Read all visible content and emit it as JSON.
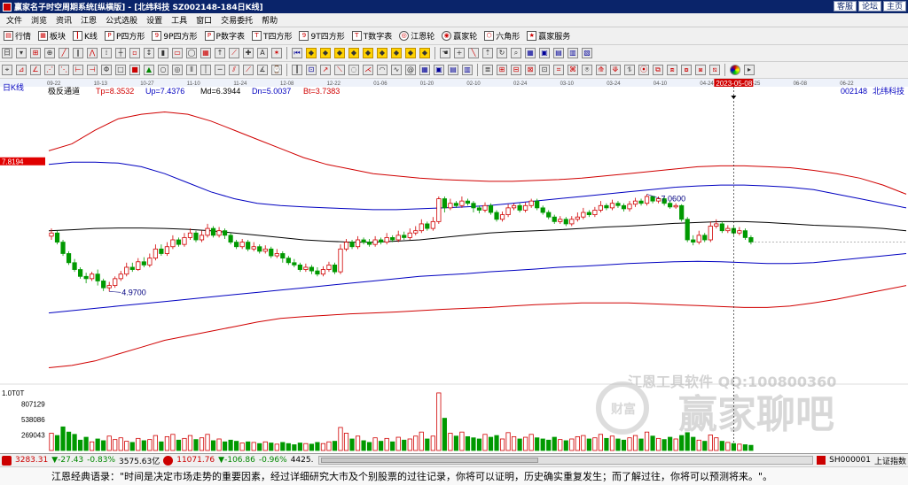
{
  "window": {
    "title": "赢家名子时空周期系统[纵横版] - [北纬科技  SZ002148-184日K线]",
    "links": [
      "客服",
      "论坛",
      "主页"
    ]
  },
  "menu": [
    "文件",
    "浏览",
    "资讯",
    "江恩",
    "公式选股",
    "设置",
    "工具",
    "窗口",
    "交易委托",
    "帮助"
  ],
  "toolbar1": [
    {
      "label": "行情",
      "icon": "quote-icon"
    },
    {
      "label": "板块",
      "icon": "sector-icon"
    },
    {
      "label": "K线",
      "icon": "kline-icon"
    },
    {
      "label": "P四方形",
      "icon": "p-square-icon"
    },
    {
      "label": "9P四方形",
      "icon": "9p-square-icon"
    },
    {
      "label": "P数字表",
      "icon": "p-table-icon"
    },
    {
      "label": "T四方形",
      "icon": "t-square-icon"
    },
    {
      "label": "9T四方形",
      "icon": "9t-square-icon"
    },
    {
      "label": "T数字表",
      "icon": "t-table-icon"
    },
    {
      "label": "江恩轮",
      "icon": "gann-wheel-icon"
    },
    {
      "label": "赢家轮",
      "icon": "winner-wheel-icon"
    },
    {
      "label": "六角形",
      "icon": "hexagon-icon"
    },
    {
      "label": "赢家服务",
      "icon": "service-icon"
    }
  ],
  "chart": {
    "panel_label": "日K线",
    "indicator_name": "极反通道",
    "params": [
      {
        "label": "Tp=8.3532",
        "color": "#d00000"
      },
      {
        "label": "Up=7.4376",
        "color": "#0000c0"
      },
      {
        "label": "Md=6.3944",
        "color": "#000000"
      },
      {
        "label": "Dn=5.0037",
        "color": "#0000c0"
      },
      {
        "label": "Bt=3.7383",
        "color": "#d00000"
      }
    ],
    "stock_code": "002148",
    "stock_name": "北纬科技",
    "price_tag": "7.8194",
    "volume_top_label": "1.0T0T",
    "volume_ticks": [
      "807129",
      "538086",
      "269043"
    ],
    "cursor_date": "2023-05-08",
    "low_label": "4.9700",
    "high_label": "7.0600",
    "date_ticks": [
      "09-22",
      "10-13",
      "10-27",
      "11-10",
      "11-24",
      "12-08",
      "12-22",
      "01-06",
      "01-20",
      "02-10",
      "02-24",
      "03-10",
      "03-24",
      "04-10",
      "04-24",
      "05-25",
      "06-08",
      "06-22"
    ],
    "watermark_line1": "江恩工具软件   QQ:100800360",
    "watermark_line2": "赢家聊吧",
    "watermark_logo": "财富"
  },
  "status": {
    "sh_index": "3283.31",
    "sh_change": "▼-27.43",
    "sh_pct": "-0.83%",
    "sh_amount": "3575.63亿",
    "sz_index": "11071.76",
    "sz_change": "▼-106.86",
    "sz_pct": "-0.96%",
    "sz_amount": "4425.",
    "right_code": "SH000001",
    "right_name": "上证指数"
  },
  "quote": "江恩经典语录：\"时间是决定市场走势的重要因素，经过详细研究大市及个别股票的过往记录，你将可以证明，历史确实重复发生；而了解过往，你将可以预测将来。\"。",
  "colors": {
    "up": "#d00000",
    "down": "#009900",
    "upper_band": "#d00000",
    "mid_band": "#0000c0",
    "middle": "#000000"
  },
  "chart_data": {
    "type": "candlestick",
    "title": "",
    "xlabel": "",
    "ylabel": "",
    "ylim": [
      3.0,
      9.2
    ],
    "vol_ylim": [
      0,
      1076172
    ],
    "bands": {
      "Tp": [
        8.05,
        8.2,
        8.5,
        8.75,
        8.85,
        8.9,
        8.85,
        8.7,
        8.5,
        8.3,
        8.1,
        7.9,
        7.75,
        7.65,
        7.55,
        7.5,
        7.45,
        7.42,
        7.4,
        7.38,
        7.38,
        7.4,
        7.42,
        7.45,
        7.5,
        7.55,
        7.6,
        7.65,
        7.7,
        7.72,
        7.72,
        7.7,
        7.68,
        7.62,
        7.55,
        7.45,
        7.3,
        7.1
      ],
      "Up": [
        7.75,
        7.8,
        7.8,
        7.78,
        7.7,
        7.55,
        7.35,
        7.15,
        7.0,
        6.9,
        6.85,
        6.82,
        6.8,
        6.78,
        6.76,
        6.76,
        6.78,
        6.8,
        6.82,
        6.85,
        6.9,
        6.95,
        7.0,
        7.05,
        7.1,
        7.15,
        7.2,
        7.25,
        7.28,
        7.3,
        7.3,
        7.28,
        7.25,
        7.2,
        7.1,
        7.0,
        6.9,
        6.8
      ],
      "Md": [
        6.3,
        6.32,
        6.35,
        6.36,
        6.36,
        6.35,
        6.33,
        6.3,
        6.25,
        6.2,
        6.15,
        6.1,
        6.07,
        6.05,
        6.05,
        6.07,
        6.1,
        6.15,
        6.2,
        6.25,
        6.28,
        6.3,
        6.32,
        6.35,
        6.38,
        6.4,
        6.43,
        6.46,
        6.48,
        6.5,
        6.5,
        6.48,
        6.45,
        6.42,
        6.4,
        6.38,
        6.35,
        6.3
      ],
      "Dn": [
        4.5,
        4.55,
        4.6,
        4.65,
        4.7,
        4.75,
        4.8,
        4.85,
        4.9,
        4.95,
        5.0,
        5.05,
        5.1,
        5.15,
        5.2,
        5.25,
        5.3,
        5.33,
        5.36,
        5.4,
        5.43,
        5.46,
        5.5,
        5.52,
        5.55,
        5.58,
        5.6,
        5.62,
        5.63,
        5.62,
        5.6,
        5.58,
        5.58,
        5.6,
        5.65,
        5.7,
        5.75,
        5.8
      ],
      "Bt": [
        3.3,
        3.35,
        3.45,
        3.6,
        3.75,
        3.9,
        4.0,
        4.1,
        4.2,
        4.3,
        4.38,
        4.42,
        4.45,
        4.48,
        4.5,
        4.52,
        4.55,
        4.58,
        4.6,
        4.62,
        4.65,
        4.68,
        4.7,
        4.72,
        4.72,
        4.72,
        4.7,
        4.68,
        4.66,
        4.64,
        4.62,
        4.62,
        4.65,
        4.72,
        4.8,
        4.9,
        5.0,
        5.1
      ]
    },
    "candles": [
      [
        6.18,
        6.25,
        6.35,
        6.1
      ],
      [
        6.25,
        6.05,
        6.3,
        6.0
      ],
      [
        6.05,
        5.8,
        6.1,
        5.75
      ],
      [
        5.8,
        5.6,
        5.85,
        5.55
      ],
      [
        5.6,
        5.45,
        5.68,
        5.4
      ],
      [
        5.45,
        5.3,
        5.5,
        5.25
      ],
      [
        5.3,
        5.25,
        5.38,
        5.15
      ],
      [
        5.25,
        5.35,
        5.4,
        5.2
      ],
      [
        5.35,
        5.2,
        5.45,
        5.1
      ],
      [
        5.2,
        5.05,
        5.25,
        4.98
      ],
      [
        5.05,
        5.1,
        5.18,
        4.97
      ],
      [
        5.1,
        5.25,
        5.3,
        5.05
      ],
      [
        5.25,
        5.35,
        5.42,
        5.2
      ],
      [
        5.35,
        5.5,
        5.6,
        5.3
      ],
      [
        5.5,
        5.45,
        5.6,
        5.4
      ],
      [
        5.45,
        5.62,
        5.7,
        5.42
      ],
      [
        5.62,
        5.55,
        5.72,
        5.5
      ],
      [
        5.55,
        5.7,
        5.8,
        5.5
      ],
      [
        5.7,
        5.9,
        6.0,
        5.65
      ],
      [
        5.9,
        5.8,
        6.0,
        5.75
      ],
      [
        5.8,
        5.95,
        6.05,
        5.75
      ],
      [
        5.95,
        6.1,
        6.2,
        5.9
      ],
      [
        6.1,
        6.0,
        6.15,
        5.95
      ],
      [
        6.0,
        6.15,
        6.25,
        5.95
      ],
      [
        6.15,
        6.25,
        6.35,
        6.1
      ],
      [
        6.25,
        6.1,
        6.3,
        6.05
      ],
      [
        6.1,
        6.2,
        6.3,
        6.05
      ],
      [
        6.2,
        6.35,
        6.45,
        6.15
      ],
      [
        6.35,
        6.2,
        6.4,
        6.15
      ],
      [
        6.2,
        6.3,
        6.38,
        6.15
      ],
      [
        6.3,
        6.2,
        6.35,
        6.12
      ],
      [
        6.2,
        6.05,
        6.25,
        6.0
      ],
      [
        6.05,
        5.95,
        6.1,
        5.9
      ],
      [
        5.95,
        6.05,
        6.12,
        5.9
      ],
      [
        6.05,
        5.9,
        6.1,
        5.85
      ],
      [
        5.9,
        5.95,
        6.05,
        5.85
      ],
      [
        5.95,
        5.85,
        6.0,
        5.8
      ],
      [
        5.85,
        5.9,
        5.98,
        5.8
      ],
      [
        5.9,
        5.75,
        5.95,
        5.7
      ],
      [
        5.75,
        5.8,
        5.9,
        5.7
      ],
      [
        5.8,
        5.7,
        5.85,
        5.6
      ],
      [
        5.7,
        5.6,
        5.75,
        5.55
      ],
      [
        5.6,
        5.55,
        5.68,
        5.5
      ],
      [
        5.55,
        5.45,
        5.6,
        5.4
      ],
      [
        5.45,
        5.5,
        5.58,
        5.4
      ],
      [
        5.5,
        5.42,
        5.55,
        5.35
      ],
      [
        5.42,
        5.35,
        5.5,
        5.3
      ],
      [
        5.35,
        5.45,
        5.52,
        5.3
      ],
      [
        5.45,
        5.55,
        5.62,
        5.4
      ],
      [
        5.55,
        5.4,
        5.6,
        5.35
      ],
      [
        5.4,
        5.9,
        6.0,
        5.35
      ],
      [
        5.9,
        6.05,
        6.12,
        5.85
      ],
      [
        6.05,
        5.95,
        6.1,
        5.9
      ],
      [
        5.95,
        6.1,
        6.18,
        5.9
      ],
      [
        6.1,
        6.05,
        6.15,
        6.0
      ],
      [
        6.05,
        6.0,
        6.12,
        5.95
      ],
      [
        6.0,
        6.1,
        6.18,
        5.95
      ],
      [
        6.1,
        6.05,
        6.15,
        6.0
      ],
      [
        6.05,
        6.15,
        6.25,
        6.0
      ],
      [
        6.15,
        6.1,
        6.2,
        6.05
      ],
      [
        6.1,
        6.2,
        6.3,
        6.05
      ],
      [
        6.2,
        6.15,
        6.28,
        6.1
      ],
      [
        6.15,
        6.25,
        6.35,
        6.1
      ],
      [
        6.25,
        6.3,
        6.4,
        6.2
      ],
      [
        6.3,
        6.45,
        6.55,
        6.25
      ],
      [
        6.45,
        6.35,
        6.5,
        6.3
      ],
      [
        6.35,
        6.5,
        6.6,
        6.3
      ],
      [
        6.5,
        7.0,
        7.05,
        6.45
      ],
      [
        7.0,
        6.8,
        7.05,
        6.7
      ],
      [
        6.8,
        6.9,
        7.0,
        6.75
      ],
      [
        6.9,
        6.85,
        6.95,
        6.8
      ],
      [
        6.85,
        6.95,
        7.05,
        6.8
      ],
      [
        6.95,
        6.9,
        7.0,
        6.85
      ],
      [
        6.9,
        6.8,
        6.95,
        6.7
      ],
      [
        6.8,
        6.75,
        6.85,
        6.68
      ],
      [
        6.75,
        6.85,
        6.92,
        6.7
      ],
      [
        6.85,
        6.7,
        6.9,
        6.65
      ],
      [
        6.7,
        6.55,
        6.75,
        6.5
      ],
      [
        6.55,
        6.65,
        6.72,
        6.5
      ],
      [
        6.65,
        6.8,
        6.88,
        6.6
      ],
      [
        6.8,
        6.85,
        6.9,
        6.75
      ],
      [
        6.85,
        6.75,
        6.9,
        6.7
      ],
      [
        6.75,
        6.85,
        6.92,
        6.7
      ],
      [
        6.85,
        6.95,
        7.0,
        6.8
      ],
      [
        6.95,
        6.8,
        7.0,
        6.75
      ],
      [
        6.8,
        6.7,
        6.85,
        6.65
      ],
      [
        6.7,
        6.6,
        6.75,
        6.55
      ],
      [
        6.6,
        6.5,
        6.65,
        6.45
      ],
      [
        6.5,
        6.55,
        6.62,
        6.45
      ],
      [
        6.55,
        6.45,
        6.6,
        6.4
      ],
      [
        6.45,
        6.55,
        6.62,
        6.4
      ],
      [
        6.55,
        6.6,
        6.7,
        6.5
      ],
      [
        6.6,
        6.7,
        6.8,
        6.55
      ],
      [
        6.7,
        6.65,
        6.75,
        6.6
      ],
      [
        6.65,
        6.75,
        6.82,
        6.6
      ],
      [
        6.75,
        6.85,
        6.95,
        6.7
      ],
      [
        6.85,
        6.8,
        6.9,
        6.75
      ],
      [
        6.8,
        6.9,
        6.98,
        6.75
      ],
      [
        6.9,
        6.85,
        6.95,
        6.8
      ],
      [
        6.85,
        6.78,
        6.9,
        6.72
      ],
      [
        6.78,
        6.88,
        6.95,
        6.72
      ],
      [
        6.88,
        6.95,
        7.02,
        6.82
      ],
      [
        6.95,
        6.9,
        7.0,
        6.85
      ],
      [
        6.9,
        7.05,
        7.1,
        6.85
      ],
      [
        7.05,
        6.95,
        7.06,
        6.9
      ],
      [
        6.95,
        7.0,
        7.05,
        6.9
      ],
      [
        7.0,
        6.9,
        7.03,
        6.85
      ],
      [
        6.9,
        6.82,
        6.95,
        6.78
      ],
      [
        6.82,
        6.85,
        6.9,
        6.78
      ],
      [
        6.85,
        6.55,
        6.88,
        6.5
      ],
      [
        6.55,
        6.1,
        6.6,
        6.05
      ],
      [
        6.1,
        6.05,
        6.2,
        5.98
      ],
      [
        6.05,
        6.2,
        6.3,
        6.0
      ],
      [
        6.2,
        6.1,
        6.25,
        6.05
      ],
      [
        6.1,
        6.4,
        6.5,
        6.05
      ],
      [
        6.4,
        6.45,
        6.55,
        6.35
      ],
      [
        6.45,
        6.3,
        6.5,
        6.25
      ],
      [
        6.3,
        6.35,
        6.42,
        6.25
      ],
      [
        6.35,
        6.25,
        6.4,
        6.2
      ],
      [
        6.25,
        6.3,
        6.38,
        6.2
      ],
      [
        6.3,
        6.15,
        6.35,
        6.1
      ],
      [
        6.15,
        6.05,
        6.2,
        6.0
      ]
    ],
    "volumes": [
      300000,
      260000,
      410000,
      320000,
      280000,
      180000,
      230000,
      150000,
      200000,
      170000,
      250000,
      190000,
      220000,
      160000,
      140000,
      210000,
      170000,
      190000,
      260000,
      150000,
      240000,
      280000,
      180000,
      210000,
      260000,
      190000,
      220000,
      280000,
      170000,
      200000,
      150000,
      180000,
      160000,
      130000,
      150000,
      140000,
      120000,
      150000,
      130000,
      110000,
      140000,
      120000,
      100000,
      130000,
      120000,
      110000,
      140000,
      120000,
      150000,
      160000,
      400000,
      300000,
      200000,
      250000,
      170000,
      140000,
      220000,
      160000,
      210000,
      150000,
      230000,
      180000,
      200000,
      250000,
      320000,
      200000,
      250000,
      1000000,
      560000,
      300000,
      250000,
      320000,
      240000,
      220000,
      200000,
      280000,
      230000,
      260000,
      200000,
      310000,
      240000,
      200000,
      230000,
      280000,
      220000,
      200000,
      180000,
      230000,
      190000,
      170000,
      200000,
      240000,
      260000,
      200000,
      220000,
      280000,
      210000,
      250000,
      200000,
      180000,
      220000,
      260000,
      200000,
      320000,
      250000,
      210000,
      190000,
      230000,
      200000,
      260000,
      310000,
      230000,
      180000,
      160000,
      270000,
      220000,
      160000,
      140000,
      120000,
      110000,
      100000,
      90000
    ]
  }
}
